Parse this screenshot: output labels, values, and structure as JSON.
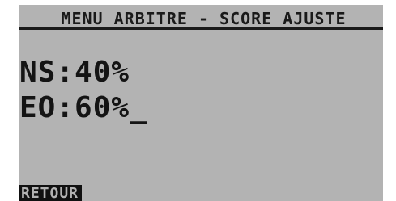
{
  "screen": {
    "title": "MENU ARBITRE - SCORE AJUSTE",
    "scores": [
      {
        "team": "NS",
        "value": "40%"
      },
      {
        "team": "EO",
        "value": "60%"
      }
    ],
    "cursor": "_",
    "softkey_left": "RETOUR"
  },
  "colors": {
    "lcd_background": "#b3b3b3",
    "text": "#141414",
    "softkey_background": "#111111"
  }
}
